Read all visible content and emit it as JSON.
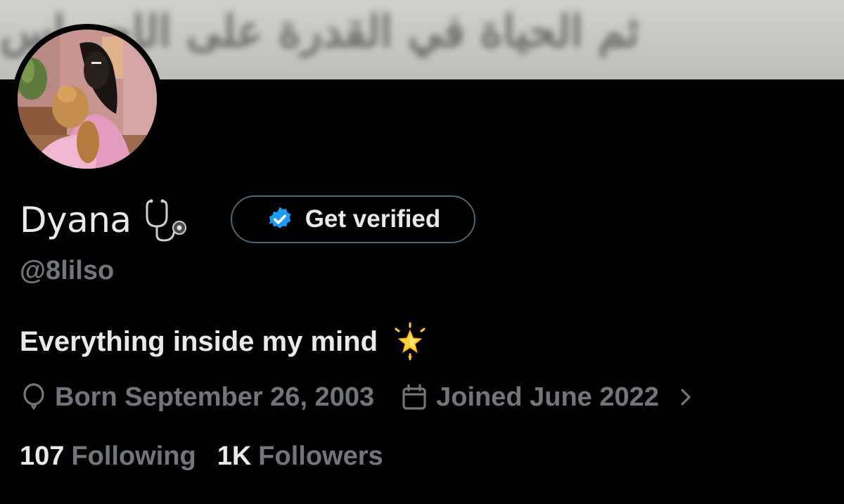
{
  "banner": {
    "text": "ثم الحياة في القدرة على الإحساس"
  },
  "profile": {
    "display_name": "Dyana",
    "name_emoji": "stethoscope-icon",
    "handle": "@8lilso",
    "bio": "Everything inside my mind",
    "bio_emoji": "glowing-star-icon"
  },
  "verify_button": {
    "label": "Get verified",
    "icon": "verified-badge-icon",
    "accent": "#1d9bf0"
  },
  "meta": {
    "birthday": "Born September 26, 2003",
    "joined": "Joined June 2022"
  },
  "stats": {
    "following_count": "107",
    "following_label": "Following",
    "followers_count": "1K",
    "followers_label": "Followers"
  },
  "colors": {
    "background": "#000000",
    "primary_text": "#e7e9ea",
    "secondary_text": "#71767b",
    "border": "#536471"
  }
}
